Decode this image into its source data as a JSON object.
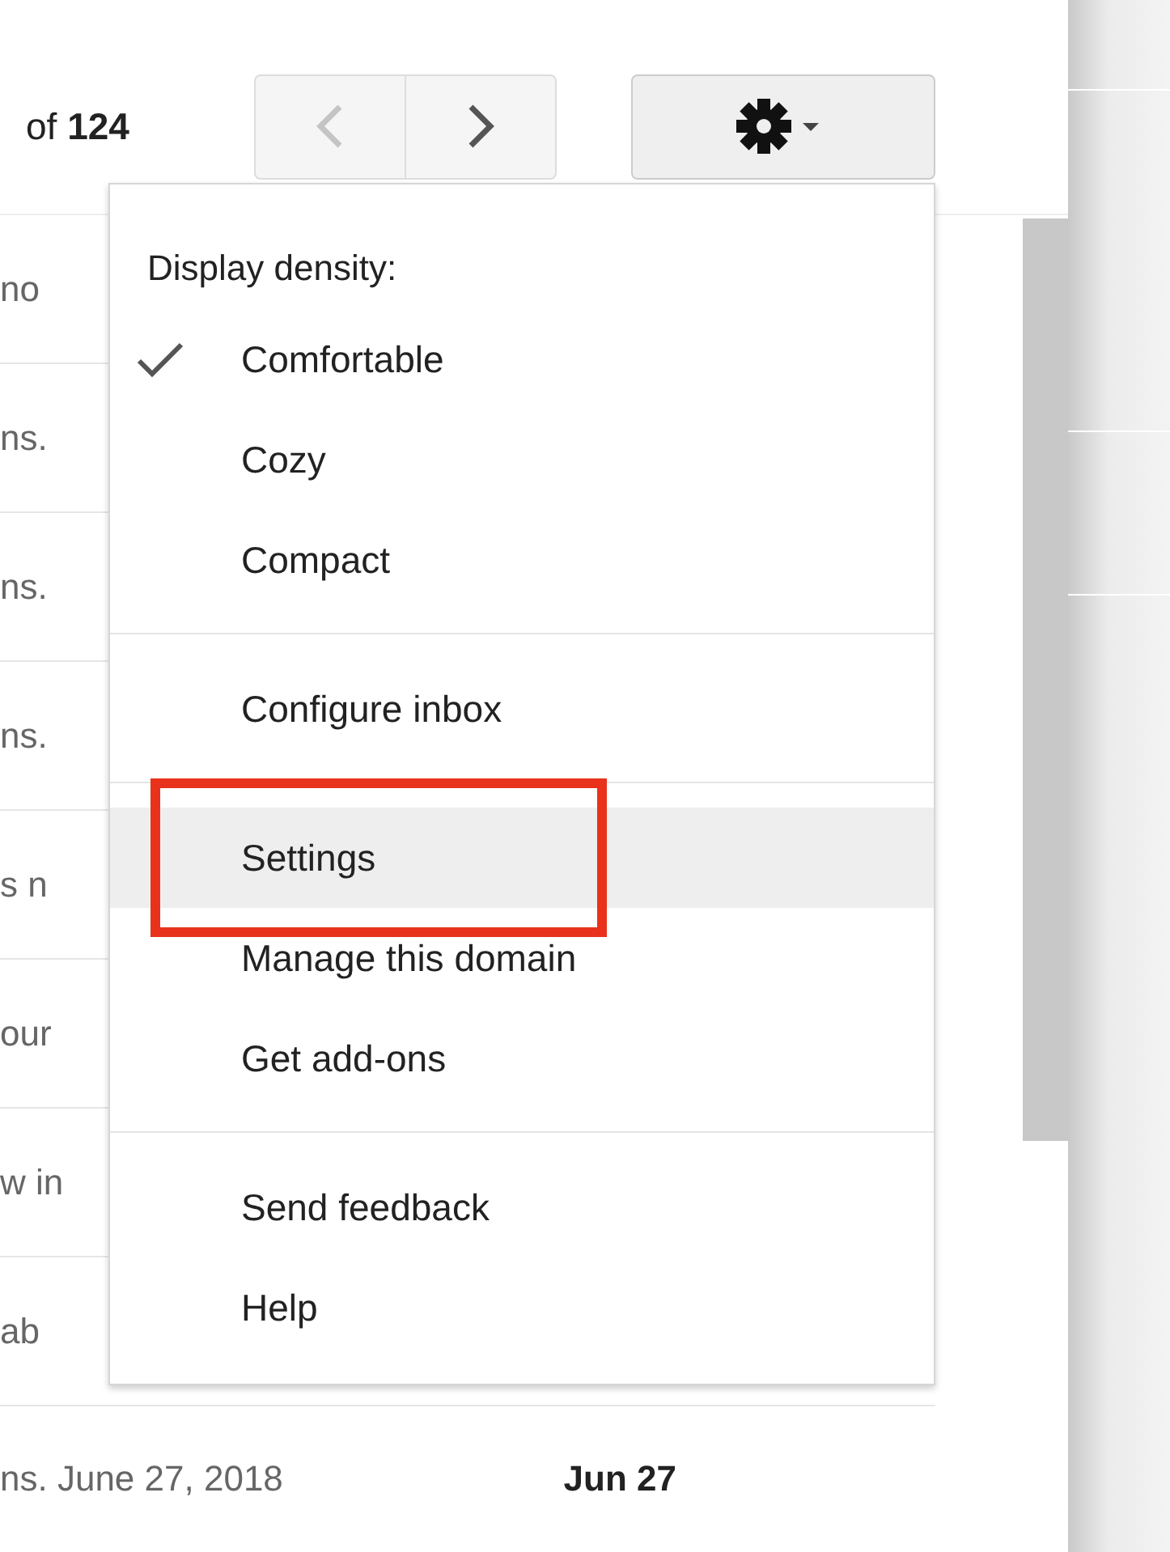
{
  "pager": {
    "range": "of **124**",
    "prev": {
      "disabled": true
    },
    "next": {
      "disabled": false
    }
  },
  "messages": [
    {
      "snippet": "no"
    },
    {
      "snippet": "ns."
    },
    {
      "snippet": "ns."
    },
    {
      "snippet": "ns."
    },
    {
      "snippet": "s n"
    },
    {
      "snippet": "our"
    },
    {
      "snippet": "w in"
    },
    {
      "snippet": "ab"
    },
    {
      "snippet": "ns. June 27, 2018",
      "date": "Jun 27"
    }
  ],
  "menu": {
    "groups": [
      {
        "heading": "Display density:",
        "items": [
          {
            "label": "Comfortable",
            "checked": true,
            "highlighted": false,
            "annotated": false
          },
          {
            "label": "Cozy",
            "checked": false,
            "highlighted": false,
            "annotated": false
          },
          {
            "label": "Compact",
            "checked": false,
            "highlighted": false,
            "annotated": false
          }
        ]
      },
      {
        "items": [
          {
            "label": "Configure inbox",
            "checked": false,
            "highlighted": false,
            "annotated": false
          }
        ]
      },
      {
        "items": [
          {
            "label": "Settings",
            "checked": false,
            "highlighted": true,
            "annotated": true
          },
          {
            "label": "Manage this domain",
            "checked": false,
            "highlighted": false,
            "annotated": false
          },
          {
            "label": "Get add-ons",
            "checked": false,
            "highlighted": false,
            "annotated": false
          }
        ]
      },
      {
        "items": [
          {
            "label": "Send feedback",
            "checked": false,
            "highlighted": false,
            "annotated": false
          },
          {
            "label": "Help",
            "checked": false,
            "highlighted": false,
            "annotated": false
          }
        ]
      }
    ]
  }
}
